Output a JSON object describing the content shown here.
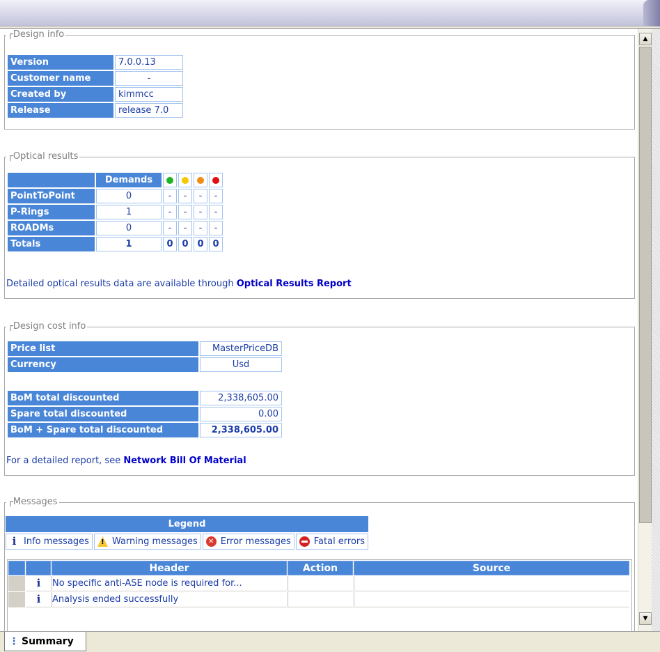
{
  "design_info": {
    "title": "Design info",
    "rows": [
      {
        "label": "Version",
        "value": "7.0.0.13"
      },
      {
        "label": "Customer name",
        "value": "-"
      },
      {
        "label": "Created by",
        "value": "kimmcc"
      },
      {
        "label": "Release",
        "value": "release 7.0"
      }
    ]
  },
  "optical_results": {
    "title": "Optical results",
    "demands_header": "Demands",
    "status_colors": [
      "#22b322",
      "#f5c800",
      "#f08c14",
      "#e01010"
    ],
    "rows": [
      {
        "label": "PointToPoint",
        "demands": "0",
        "s1": "-",
        "s2": "-",
        "s3": "-",
        "s4": "-"
      },
      {
        "label": "P-Rings",
        "demands": "1",
        "s1": "-",
        "s2": "-",
        "s3": "-",
        "s4": "-"
      },
      {
        "label": "ROADMs",
        "demands": "0",
        "s1": "-",
        "s2": "-",
        "s3": "-",
        "s4": "-"
      },
      {
        "label": "Totals",
        "demands": "1",
        "s1": "0",
        "s2": "0",
        "s3": "0",
        "s4": "0"
      }
    ],
    "note_text": "Detailed optical results data are available through ",
    "note_link": "Optical Results Report"
  },
  "cost_info": {
    "title": "Design cost info",
    "price_list_label": "Price list",
    "price_list_value": "MasterPriceDB",
    "currency_label": "Currency",
    "currency_value": "Usd",
    "bom_label": "BoM total discounted",
    "bom_value": "2,338,605.00",
    "spare_label": "Spare total discounted",
    "spare_value": "0.00",
    "total_label": "BoM + Spare total discounted",
    "total_value": "2,338,605.00",
    "note_text": "For a detailed report, see ",
    "note_link": "Network Bill Of Material"
  },
  "messages": {
    "title": "Messages",
    "legend_title": "Legend",
    "legend": [
      {
        "icon": "info-icon",
        "label": "Info messages"
      },
      {
        "icon": "warning-icon",
        "label": "Warning messages"
      },
      {
        "icon": "error-icon",
        "label": "Error messages"
      },
      {
        "icon": "fatal-error-icon",
        "label": "Fatal errors"
      }
    ],
    "columns": [
      "Header",
      "Action",
      "Source"
    ],
    "rows": [
      {
        "icon": "info-icon",
        "header": "No specific anti-ASE node is required for...",
        "action": "",
        "source": ""
      },
      {
        "icon": "info-icon",
        "header": "Analysis ended successfully",
        "action": "",
        "source": ""
      }
    ]
  },
  "tabs": {
    "summary_label": "Summary"
  }
}
